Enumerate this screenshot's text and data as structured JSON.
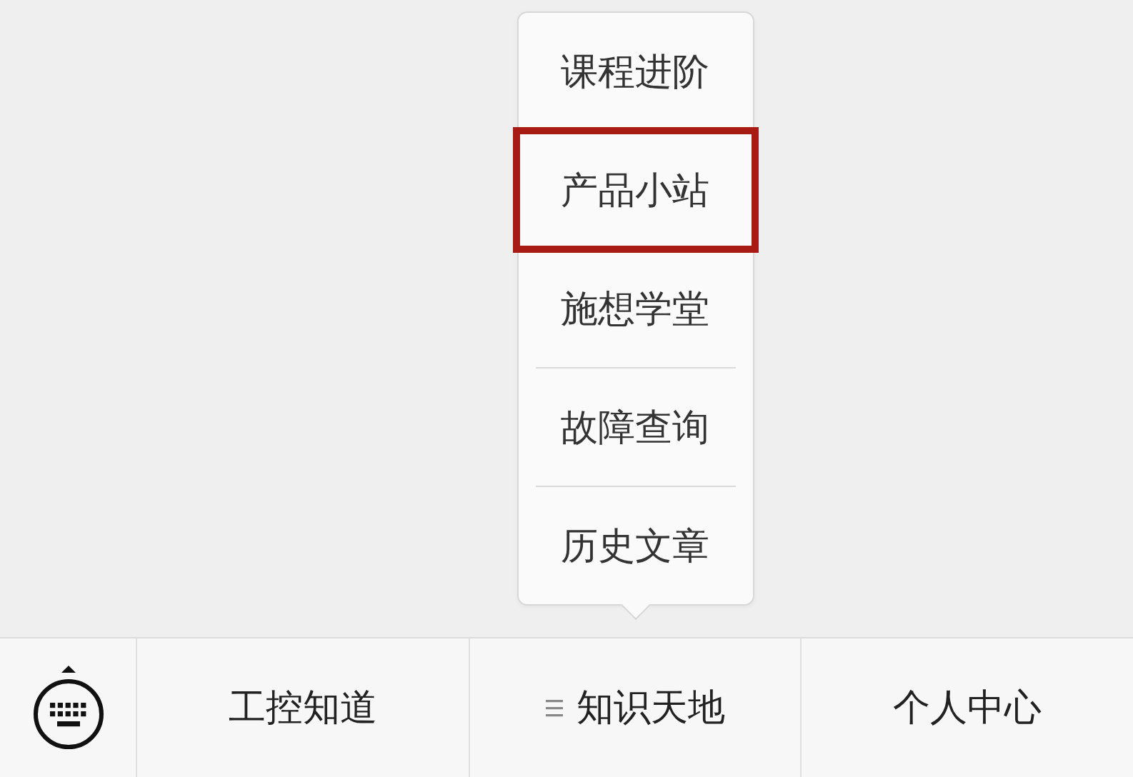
{
  "popup_menu": {
    "items": [
      {
        "label": "课程进阶",
        "highlighted": false
      },
      {
        "label": "产品小站",
        "highlighted": true
      },
      {
        "label": "施想学堂",
        "highlighted": false
      },
      {
        "label": "故障查询",
        "highlighted": false
      },
      {
        "label": "历史文章",
        "highlighted": false
      }
    ]
  },
  "bottom_bar": {
    "menus": [
      {
        "label": "工控知道",
        "submenu": false
      },
      {
        "label": "知识天地",
        "submenu": true
      },
      {
        "label": "个人中心",
        "submenu": false
      }
    ]
  }
}
